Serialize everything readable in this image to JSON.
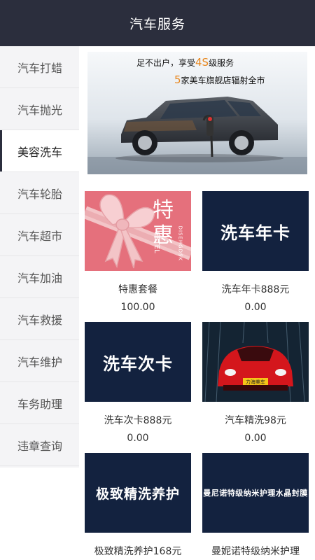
{
  "header": {
    "title": "汽车服务"
  },
  "sidebar": {
    "items": [
      {
        "label": "汽车打蜡",
        "active": false
      },
      {
        "label": "汽车抛光",
        "active": false
      },
      {
        "label": "美容洗车",
        "active": true
      },
      {
        "label": "汽车轮胎",
        "active": false
      },
      {
        "label": "汽车超市",
        "active": false
      },
      {
        "label": "汽车加油",
        "active": false
      },
      {
        "label": "汽车救援",
        "active": false
      },
      {
        "label": "汽车维护",
        "active": false
      },
      {
        "label": "车务助理",
        "active": false
      },
      {
        "label": "违章查询",
        "active": false
      }
    ]
  },
  "banner": {
    "line1_prefix": "足不出户，享受",
    "line1_highlight": "4S",
    "line1_suffix": "级服务",
    "line2_highlight": "5",
    "line2_suffix": "家美车旗舰店辐射全市"
  },
  "products": [
    {
      "name": "特惠套餐",
      "price": "100.00",
      "tile_text": "特惠",
      "tile_subtext": "DISEHGDSK",
      "tile_brand": "ESTEL"
    },
    {
      "name": "洗车年卡888元",
      "price": "0.00",
      "tile_text": "洗车年卡"
    },
    {
      "name": "洗车次卡888元",
      "price": "0.00",
      "tile_text": "洗车次卡"
    },
    {
      "name": "汽车精洗98元",
      "price": "0.00",
      "tile_text": "力海美车"
    },
    {
      "name": "极致精洗养护168元",
      "price": "",
      "tile_text": "极致精洗养护"
    },
    {
      "name": "曼妮诺特级纳米护理",
      "price": "",
      "tile_text": "曼尼诺特级纳米护理水晶封膜"
    }
  ],
  "colors": {
    "header_bg": "#2b2e3d",
    "tile_navy": "#13223f",
    "banner_orange": "#e8871e",
    "gift_pink": "#e5707c"
  }
}
